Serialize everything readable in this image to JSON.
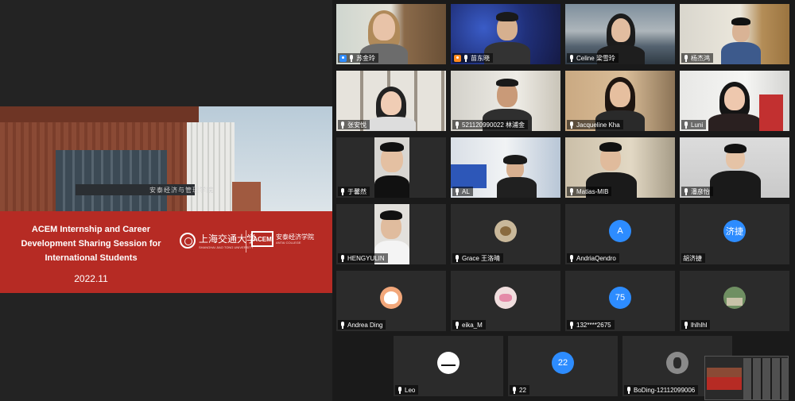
{
  "slide": {
    "title_line1": "ACEM Internship and Career",
    "title_line2": "Development Sharing Session for",
    "title_line3": "International Students",
    "date": "2022.11",
    "sjtu_name": "上海交通大学",
    "sjtu_sub": "SHANGHAI JIAO TONG UNIVERSITY",
    "acem_box": "ACEM",
    "acem_name": "安泰经济学院",
    "acem_sub": "ANTAI COLLEGE",
    "building_sign": "安泰经济与管理学院"
  },
  "participants": [
    {
      "name": "苏金玲",
      "mic": "on",
      "badge": "blue"
    },
    {
      "name": "苗东晓",
      "mic": "on",
      "badge": "orange"
    },
    {
      "name": "Celine 梁雪玲",
      "mic": "on",
      "badge": "none"
    },
    {
      "name": "杨杰鸿",
      "mic": "on",
      "badge": "none"
    },
    {
      "name": "张安悦",
      "mic": "on",
      "badge": "none"
    },
    {
      "name": "521120990022 林浦金",
      "mic": "on",
      "badge": "none"
    },
    {
      "name": "Jacqueline Kha",
      "mic": "on",
      "badge": "none"
    },
    {
      "name": "Luni",
      "mic": "on",
      "badge": "none"
    },
    {
      "name": "于馨然",
      "mic": "on",
      "badge": "none"
    },
    {
      "name": "AL",
      "mic": "on",
      "badge": "none"
    },
    {
      "name": "Matias-MIB",
      "mic": "on",
      "badge": "none"
    },
    {
      "name": "潘彦怡",
      "mic": "on",
      "badge": "none"
    },
    {
      "name": "HENGYULIN",
      "mic": "on",
      "badge": "none"
    },
    {
      "name": "Grace 王洛晴",
      "mic": "on",
      "badge": "none"
    },
    {
      "name": "AndriaQendro",
      "mic": "on",
      "badge": "none",
      "avatar": "A",
      "avatar_color": "#2d8cff"
    },
    {
      "name": "胡济捷",
      "mic": "none",
      "badge": "none",
      "avatar": "济捷",
      "avatar_color": "#2d8cff"
    },
    {
      "name": "Andrea Ding",
      "mic": "on",
      "badge": "none"
    },
    {
      "name": "eika_M",
      "mic": "on",
      "badge": "none"
    },
    {
      "name": "132****2675",
      "mic": "on",
      "badge": "none",
      "avatar": "75",
      "avatar_color": "#2d8cff"
    },
    {
      "name": "lhlhlhl",
      "mic": "on",
      "badge": "none"
    },
    {
      "name": "Leo",
      "mic": "on",
      "badge": "none"
    },
    {
      "name": "22",
      "mic": "on",
      "badge": "none",
      "avatar": "22",
      "avatar_color": "#2d8cff"
    },
    {
      "name": "BoDing-12112099006",
      "mic": "on",
      "badge": "none"
    }
  ]
}
